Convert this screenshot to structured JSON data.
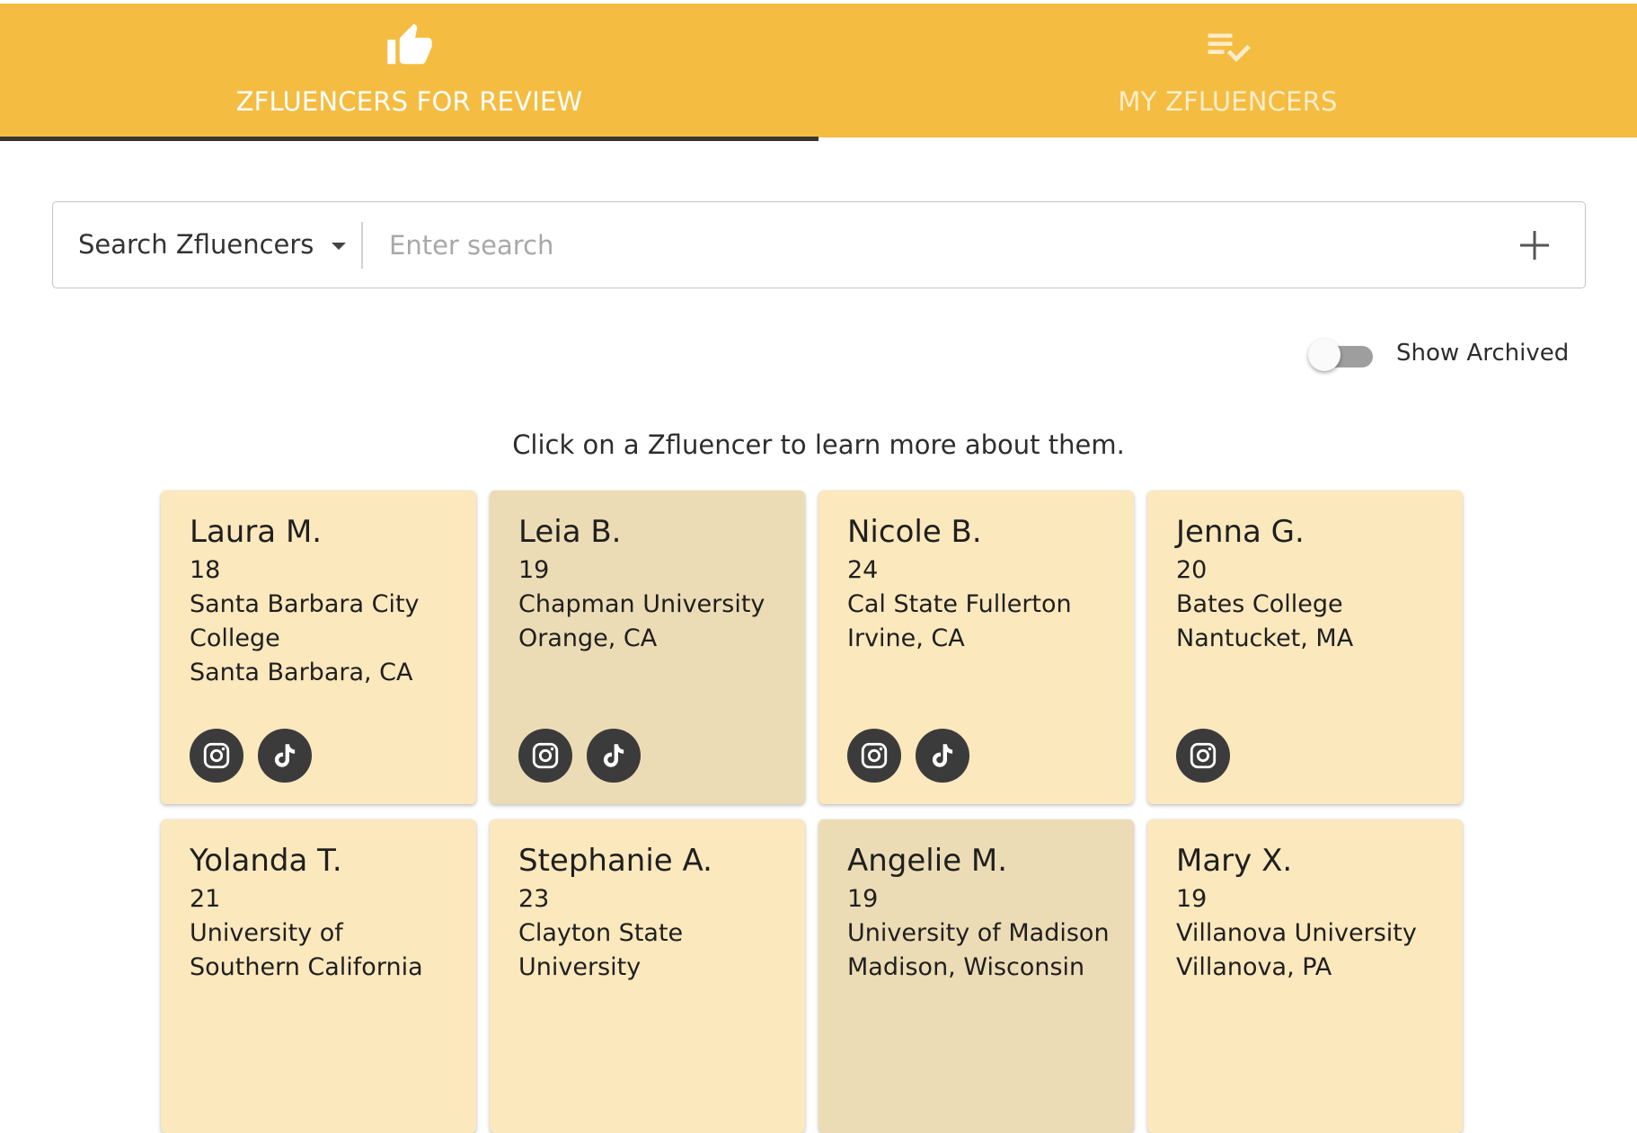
{
  "tabs": [
    {
      "label": "ZFLUENCERS FOR REVIEW",
      "icon": "thumbs-up-icon",
      "active": true
    },
    {
      "label": "MY ZFLUENCERS",
      "icon": "playlist-check-icon",
      "active": false
    }
  ],
  "colors": {
    "header": "#f4bd42",
    "indicator": "#3a3530",
    "card_light": "#fbe8bd",
    "card_dark": "#ecdcb5",
    "social_bg": "#3b3b3b"
  },
  "search": {
    "select_label": "Search Zfluencers",
    "placeholder": "Enter search",
    "value": ""
  },
  "archived": {
    "label": "Show Archived",
    "checked": false
  },
  "helper_text": "Click on a Zfluencer to learn more about them.",
  "cards": [
    {
      "name": "Laura M.",
      "age": "18",
      "school": "Santa Barbara City College",
      "location": "Santa Barbara, CA",
      "socials": [
        "instagram",
        "tiktok"
      ],
      "highlighted": false
    },
    {
      "name": "Leia B.",
      "age": "19",
      "school": "Chapman University",
      "location": "Orange, CA",
      "socials": [
        "instagram",
        "tiktok"
      ],
      "highlighted": true
    },
    {
      "name": "Nicole B.",
      "age": "24",
      "school": "Cal State Fullerton",
      "location": "Irvine, CA",
      "socials": [
        "instagram",
        "tiktok"
      ],
      "highlighted": false
    },
    {
      "name": "Jenna G.",
      "age": "20",
      "school": "Bates College",
      "location": "Nantucket, MA",
      "socials": [
        "instagram"
      ],
      "highlighted": false
    },
    {
      "name": "Yolanda T.",
      "age": "21",
      "school": "University of Southern California",
      "location": "",
      "socials": [],
      "highlighted": false
    },
    {
      "name": "Stephanie A.",
      "age": "23",
      "school": "Clayton State University",
      "location": "",
      "socials": [],
      "highlighted": false
    },
    {
      "name": "Angelie M.",
      "age": "19",
      "school": "University of Madison",
      "location": "Madison, Wisconsin",
      "socials": [],
      "highlighted": true
    },
    {
      "name": "Mary X.",
      "age": "19",
      "school": "Villanova University",
      "location": "Villanova, PA",
      "socials": [],
      "highlighted": false
    }
  ]
}
